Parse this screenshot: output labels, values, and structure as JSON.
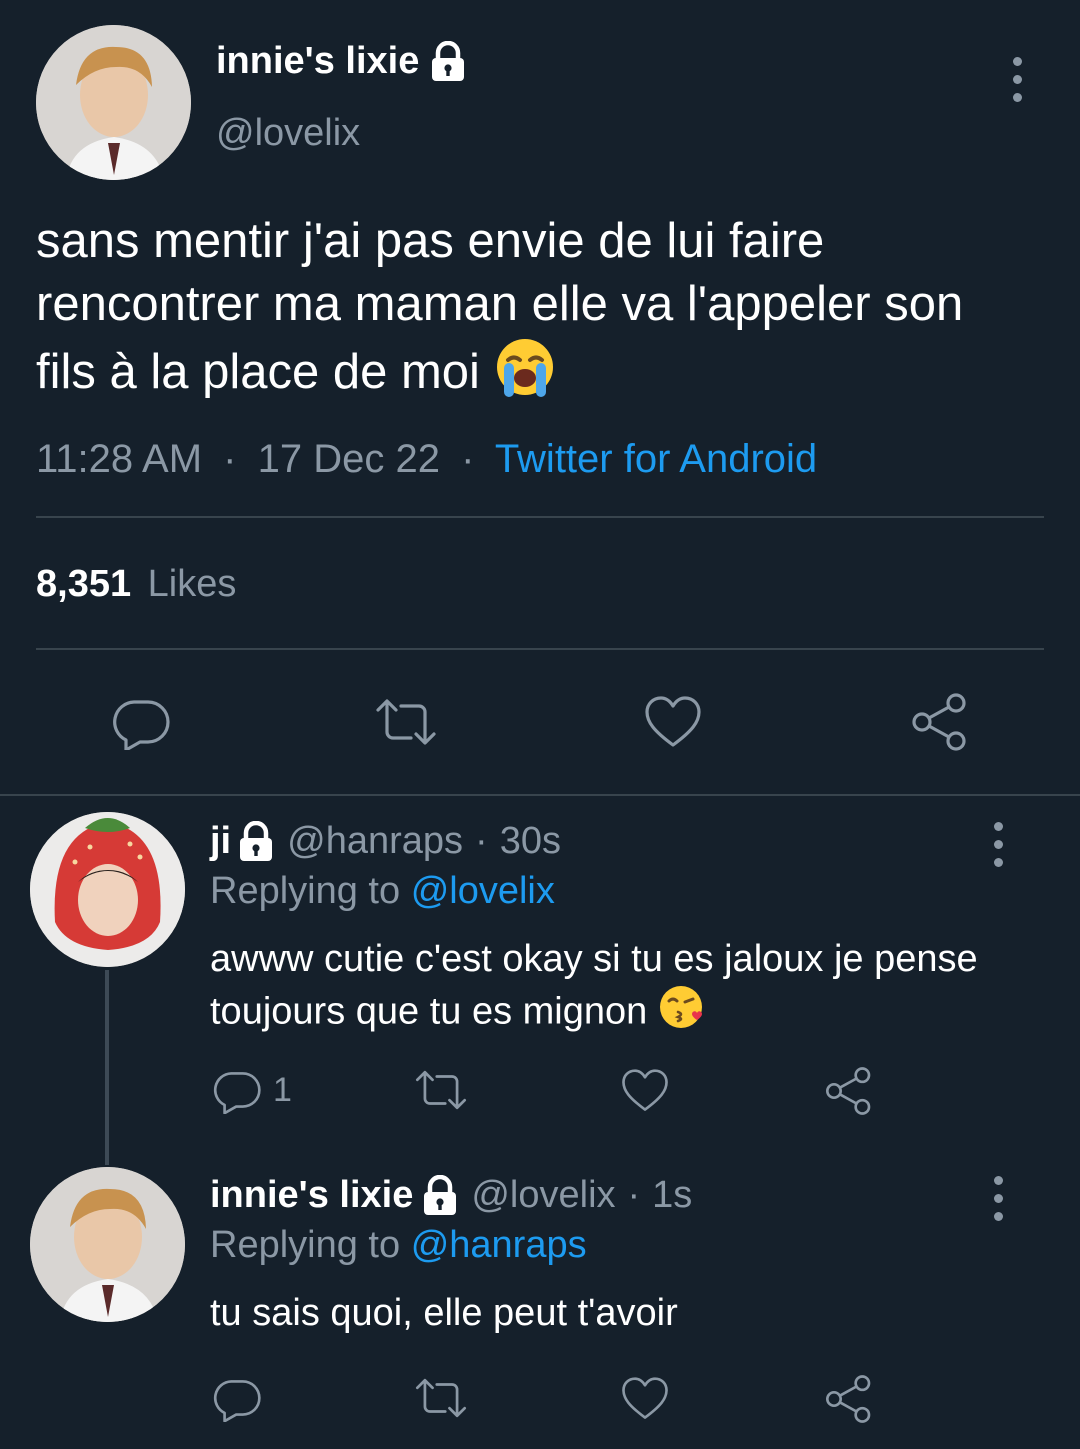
{
  "main_tweet": {
    "display_name": "innie's lixie",
    "handle": "@lovelix",
    "text": "sans mentir j'ai pas envie de lui faire rencontrer ma maman elle va l'appeler son fils à la place de moi",
    "emoji": "😭",
    "time": "11:28 AM",
    "separator": "·",
    "date": "17 Dec 22",
    "source": "Twitter for Android",
    "likes_count": "8,351",
    "likes_label": "Likes"
  },
  "replies": [
    {
      "display_name": "ji",
      "handle": "@hanraps",
      "separator": "·",
      "age": "30s",
      "replying_label": "Replying to",
      "replying_to": "@lovelix",
      "text": "awww cutie c'est okay si tu es jaloux je pense toujours que tu es mignon",
      "emoji": "😘",
      "reply_count": "1"
    },
    {
      "display_name": "innie's lixie",
      "handle": "@lovelix",
      "separator": "·",
      "age": "1s",
      "replying_label": "Replying to",
      "replying_to": "@hanraps",
      "text": "tu sais quoi, elle peut t'avoir"
    }
  ],
  "colors": {
    "background": "#15202b",
    "muted": "#8b98a5",
    "link": "#1d9bf0",
    "divider": "#38444d"
  },
  "icons": [
    "lock-icon",
    "more-icon",
    "reply-icon",
    "retweet-icon",
    "like-icon",
    "share-icon"
  ]
}
